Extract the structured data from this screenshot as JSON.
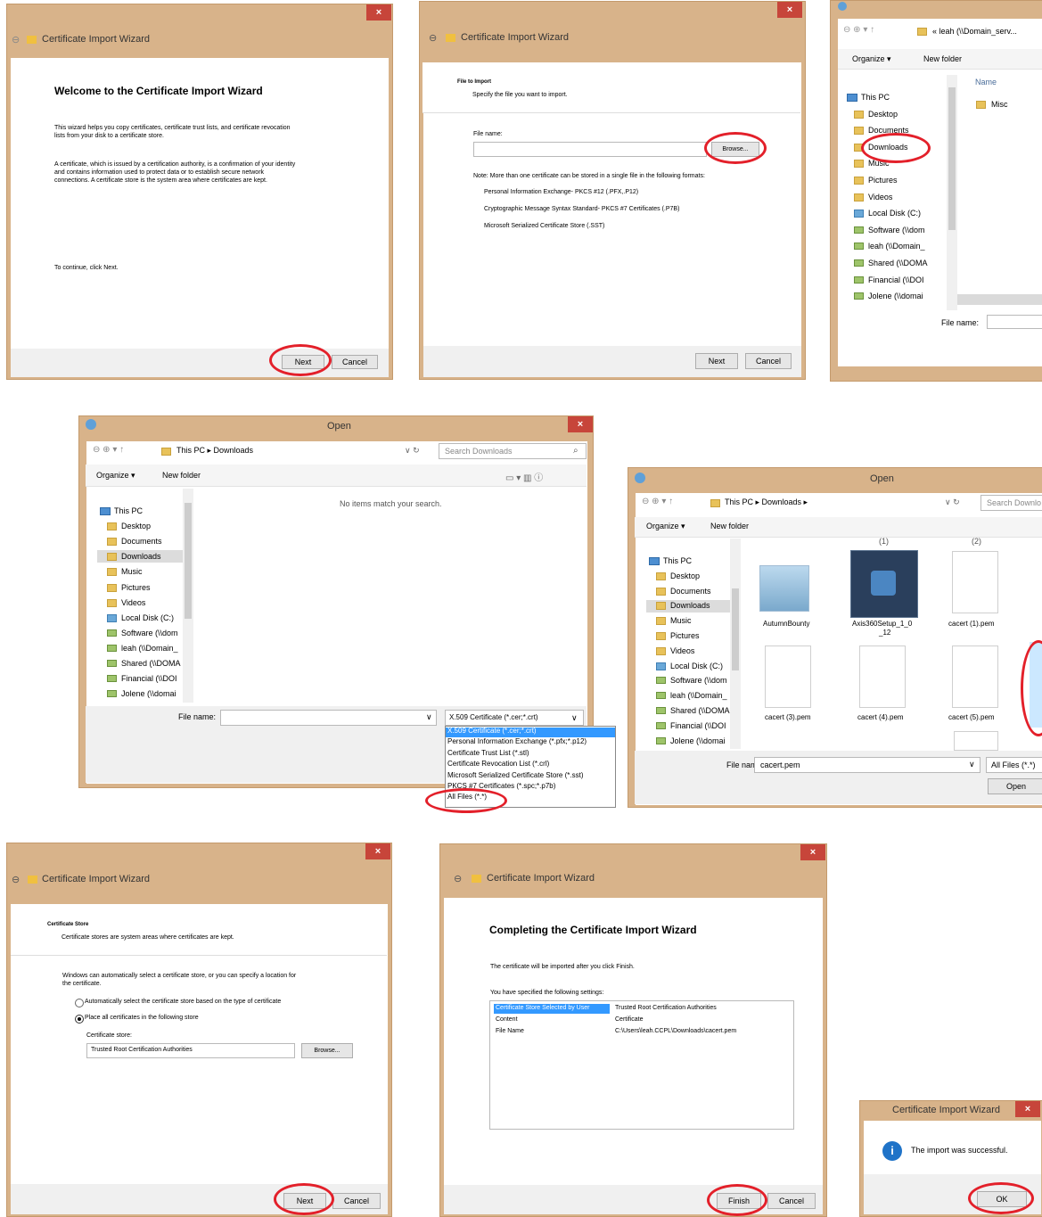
{
  "p1": {
    "title": "Certificate Import Wizard",
    "heading": "Welcome to the Certificate Import Wizard",
    "para1_l1": "This wizard helps you copy certificates, certificate trust lists, and certificate revocation",
    "para1_l2": "lists from your disk to a certificate store.",
    "para2_l1": "A certificate, which is issued by a certification authority, is a confirmation of your identity",
    "para2_l2": "and contains information used to protect data or to establish secure network",
    "para2_l3": "connections. A certificate store is the system area where certificates are kept.",
    "continue": "To continue, click Next.",
    "next": "Next",
    "cancel": "Cancel",
    "close": "×"
  },
  "p2": {
    "title": "Certificate Import Wizard",
    "section": "File to Import",
    "subtitle": "Specify the file you want to import.",
    "file_label": "File name:",
    "browse": "Browse...",
    "note": "Note:  More than one certificate can be stored in a single file in the following formats:",
    "fmt1": "Personal Information Exchange- PKCS #12 (.PFX,.P12)",
    "fmt2": "Cryptographic Message Syntax Standard- PKCS #7 Certificates (.P7B)",
    "fmt3": "Microsoft Serialized Certificate Store (.SST)",
    "next": "Next",
    "cancel": "Cancel",
    "close": "×"
  },
  "p3": {
    "path": "« leah (\\\\Domain_serv...",
    "organize": "Organize ▾",
    "new_folder": "New folder",
    "col_name": "Name",
    "item_misc": "Misc",
    "tree": [
      "This PC",
      "Desktop",
      "Documents",
      "Downloads",
      "Music",
      "Pictures",
      "Videos",
      "Local Disk (C:)",
      "Software (\\\\dom",
      "leah (\\\\Domain_",
      "Shared (\\\\DOMA",
      "Financial (\\\\DOI",
      "Jolene (\\\\domai"
    ],
    "file_label": "File name:"
  },
  "p4": {
    "title": "Open",
    "crumbs": "This PC  ▸  Downloads",
    "search": "Search Downloads",
    "organize": "Organize ▾",
    "new_folder": "New folder",
    "empty": "No items match your search.",
    "tree": [
      "This PC",
      "Desktop",
      "Documents",
      "Downloads",
      "Music",
      "Pictures",
      "Videos",
      "Local Disk (C:)",
      "Software (\\\\dom",
      "leah (\\\\Domain_",
      "Shared (\\\\DOMA",
      "Financial (\\\\DOI",
      "Jolene (\\\\domai"
    ],
    "file_label": "File name:",
    "filter": "X.509 Certificate (*.cer;*.crt)",
    "options": [
      "X.509 Certificate (*.cer;*.crt)",
      "Personal Information Exchange (*.pfx;*.p12)",
      "Certificate Trust List (*.stl)",
      "Certificate Revocation List (*.crl)",
      "Microsoft Serialized Certificate Store (*.sst)",
      "PKCS #7 Certificates (*.spc;*.p7b)",
      "All Files (*.*)"
    ],
    "close": "×"
  },
  "p5": {
    "title": "Open",
    "crumbs": "This PC  ▸  Downloads  ▸",
    "search": "Search Downlo",
    "organize": "Organize ▾",
    "new_folder": "New folder",
    "col1": "(1)",
    "col2": "(2)",
    "tree": [
      "This PC",
      "Desktop",
      "Documents",
      "Downloads",
      "Music",
      "Pictures",
      "Videos",
      "Local Disk (C:)",
      "Software (\\\\dom",
      "leah (\\\\Domain_",
      "Shared (\\\\DOMA",
      "Financial (\\\\DOI",
      "Jolene (\\\\domai"
    ],
    "files": [
      "AutumnBounty",
      "Axis360Setup_1_0",
      "cacert (1).pem",
      "cacert (3).pem",
      "cacert (4).pem",
      "cacert (5).pem"
    ],
    "file2_line2": "_12",
    "file_label": "File name:",
    "file_value": "cacert.pem",
    "filter": "All Files (*.*)",
    "open": "Open"
  },
  "p6": {
    "title": "Certificate Import Wizard",
    "section": "Certificate Store",
    "subtitle": "Certificate stores are system areas where certificates are kept.",
    "intro_l1": "Windows can automatically select a certificate store, or you can specify a location for",
    "intro_l2": "the certificate.",
    "radio_auto": "Automatically select the certificate store based on the type of certificate",
    "radio_place": "Place all certificates in the following store",
    "store_label": "Certificate store:",
    "store_value": "Trusted Root Certification Authorities",
    "browse": "Browse...",
    "next": "Next",
    "cancel": "Cancel",
    "close": "×"
  },
  "p7": {
    "title": "Certificate Import Wizard",
    "heading": "Completing the Certificate Import Wizard",
    "line1": "The certificate will be imported after you click Finish.",
    "line2": "You have specified the following settings:",
    "rows": [
      {
        "key": "Certificate Store Selected by User",
        "val": "Trusted Root Certification Authorities"
      },
      {
        "key": "Content",
        "val": "Certificate"
      },
      {
        "key": "File Name",
        "val": "C:\\Users\\leah.CCPL\\Downloads\\cacert.pem"
      }
    ],
    "finish": "Finish",
    "cancel": "Cancel",
    "close": "×"
  },
  "p8": {
    "title": "Certificate Import Wizard",
    "message": "The import was successful.",
    "ok": "OK",
    "close": "×",
    "info": "i"
  },
  "colors": {
    "accent": "#e3202a",
    "frame": "#d8b38a",
    "selection": "#3399ff"
  }
}
